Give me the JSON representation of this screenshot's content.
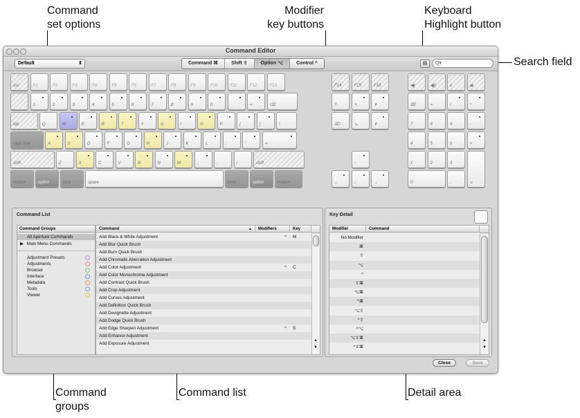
{
  "callouts": {
    "command_set_options": [
      "Command",
      "set options"
    ],
    "modifier_key_buttons": [
      "Modifier",
      "key buttons"
    ],
    "keyboard_highlight_button": [
      "Keyboard",
      "Highlight button"
    ],
    "search_field": "Search field",
    "command_groups": [
      "Command",
      "groups"
    ],
    "command_list": "Command list",
    "detail_area": "Detail area"
  },
  "window": {
    "title": "Command Editor",
    "command_set": "Default",
    "modifiers": [
      {
        "label": "Command ⌘",
        "active": false
      },
      {
        "label": "Shift ⇧",
        "active": false
      },
      {
        "label": "Option ⌥",
        "active": true
      },
      {
        "label": "Control ^",
        "active": false
      }
    ],
    "highlight_icon": "keyboard-icon",
    "search_placeholder": "Q▾"
  },
  "keyboard": {
    "rows": {
      "fn": [
        "esc",
        "F1",
        "F2",
        "F3",
        "F4",
        "F5",
        "F6",
        "F7",
        "F8",
        "F9",
        "F10",
        "F11",
        "F12",
        "F13"
      ],
      "num": [
        "",
        "1",
        "2",
        "3",
        "4",
        "5",
        "6",
        "7",
        "8",
        "9",
        "0",
        "",
        "=",
        "⌫"
      ],
      "qwerty": [
        "tab",
        "Q",
        "W",
        "E",
        "R",
        "T",
        "Y",
        "U",
        "I",
        "O",
        "P",
        "[",
        "]",
        "\\"
      ],
      "home": [
        "caps lock",
        "A",
        "S",
        "D",
        "F",
        "G",
        "H",
        "J",
        "K",
        "L",
        ";",
        "'",
        "↵"
      ],
      "shift": [
        "shift",
        "Z",
        "X",
        "C",
        "V",
        "B",
        "N",
        "M",
        ",",
        ".",
        "/",
        "shift"
      ],
      "bottom": [
        "control",
        "option",
        "cmd",
        "space",
        "cmd",
        "option",
        "control"
      ]
    },
    "nav_top": [
      "F14",
      "F15",
      "F16"
    ],
    "nav_mid": [
      "?",
      "↖",
      "⇞",
      "⌦",
      "↘",
      "⇟"
    ],
    "arrows": [
      "↑",
      "←",
      "↓",
      "→"
    ],
    "pad_top": [
      "◀)",
      "◀))",
      "≤",
      "⏏"
    ],
    "pad": [
      "⌧",
      "=",
      "/",
      "*",
      "7",
      "8",
      "9",
      "-",
      "4",
      "5",
      "6",
      "+",
      "1",
      "2",
      "3",
      "0",
      ".",
      "⌅"
    ]
  },
  "command_list": {
    "title": "Command List",
    "groups_header": "Command Groups",
    "groups_top": [
      "All Aperture Commands",
      "Main Menu Commands"
    ],
    "groups": [
      {
        "label": "Adjustment Presets",
        "color": "#c98fd6"
      },
      {
        "label": "Adjustments",
        "color": "#e5907f"
      },
      {
        "label": "Browser",
        "color": "#7fc97f"
      },
      {
        "label": "Interface",
        "color": "#8d8be0"
      },
      {
        "label": "Metadata",
        "color": "#e8947e"
      },
      {
        "label": "Tools",
        "color": "#7fa6e0"
      },
      {
        "label": "Viewer",
        "color": "#d9c85a"
      }
    ],
    "columns": {
      "command": "Command",
      "sort": "▲",
      "modifiers": "Modifiers",
      "key": "Key"
    },
    "rows": [
      {
        "command": "Add Black & White Adjustment",
        "modifiers": "^",
        "key": "M"
      },
      {
        "command": "Add Blur Quick Brush",
        "modifiers": "",
        "key": ""
      },
      {
        "command": "Add Burn Quick Brush",
        "modifiers": "",
        "key": ""
      },
      {
        "command": "Add Chromatic Aberration Adjustment",
        "modifiers": "",
        "key": ""
      },
      {
        "command": "Add Color Adjustment",
        "modifiers": "^",
        "key": "C"
      },
      {
        "command": "Add Color Monochrome Adjustment",
        "modifiers": "",
        "key": ""
      },
      {
        "command": "Add Contrast Quick Brush",
        "modifiers": "",
        "key": ""
      },
      {
        "command": "Add Crop Adjustment",
        "modifiers": "",
        "key": ""
      },
      {
        "command": "Add Curves Adjustment",
        "modifiers": "",
        "key": ""
      },
      {
        "command": "Add Definition Quick Brush",
        "modifiers": "",
        "key": ""
      },
      {
        "command": "Add Devignette Adjustment",
        "modifiers": "",
        "key": ""
      },
      {
        "command": "Add Dodge Quick Brush",
        "modifiers": "",
        "key": ""
      },
      {
        "command": "Add Edge Sharpen Adjustment",
        "modifiers": "^",
        "key": "S"
      },
      {
        "command": "Add Enhance Adjustment",
        "modifiers": "",
        "key": ""
      },
      {
        "command": "Add Exposure Adjustment",
        "modifiers": "",
        "key": ""
      }
    ]
  },
  "key_detail": {
    "title": "Key Detail",
    "columns": {
      "modifier": "Modifier",
      "command": "Command"
    },
    "rows": [
      "No Modifier",
      "⌘",
      "⇧",
      "⌥",
      "^",
      "⇧⌘",
      "⌥⌘",
      "^⌘",
      "⌥⇧",
      "^⇧",
      "^⌥",
      "⌥⇧⌘",
      "^⇧⌘"
    ]
  },
  "buttons": {
    "close": "Close",
    "save": "Save"
  }
}
